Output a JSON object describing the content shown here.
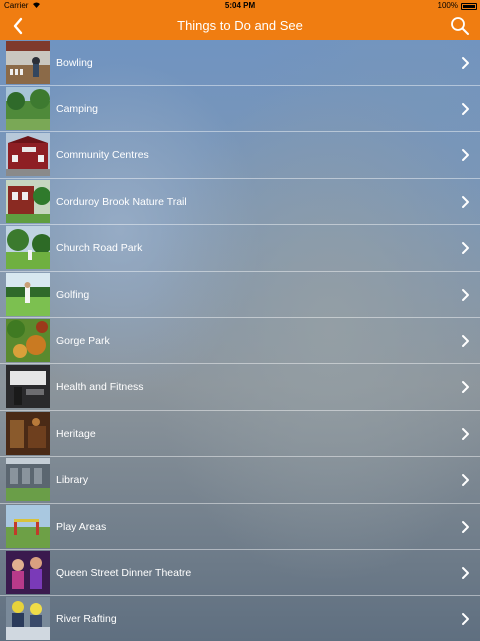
{
  "status_bar": {
    "carrier": "Carrier",
    "time": "5:04 PM",
    "battery": "100%"
  },
  "nav": {
    "title": "Things to Do and See",
    "back_icon": "chevron-left-icon",
    "search_icon": "search-icon",
    "bar_color": "#f07d11"
  },
  "list": {
    "items": [
      {
        "label": "Bowling"
      },
      {
        "label": "Camping"
      },
      {
        "label": "Community Centres"
      },
      {
        "label": "Corduroy Brook Nature Trail"
      },
      {
        "label": "Church Road Park"
      },
      {
        "label": "Golfing"
      },
      {
        "label": "Gorge Park"
      },
      {
        "label": "Health and Fitness"
      },
      {
        "label": "Heritage"
      },
      {
        "label": "Library"
      },
      {
        "label": "Play Areas"
      },
      {
        "label": "Queen Street Dinner Theatre"
      },
      {
        "label": "River Rafting"
      }
    ]
  }
}
